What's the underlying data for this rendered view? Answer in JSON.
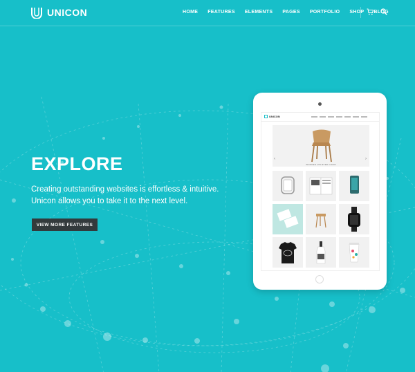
{
  "brand": {
    "name": "UNICON"
  },
  "nav": {
    "items": [
      "HOME",
      "FEATURES",
      "ELEMENTS",
      "PAGES",
      "PORTFOLIO",
      "SHOP",
      "BLOG"
    ],
    "icons": [
      "cart-icon",
      "search-icon"
    ]
  },
  "hero": {
    "title": "EXPLORE",
    "subtitle": "Creating outstanding websites is effortless & intuitive. Unicon allows you to take it to the next level.",
    "cta_label": "VIEW MORE FEATURES"
  },
  "tablet_screen": {
    "logo": "UNICON",
    "slider_caption": "WOODEN UPLIFTED CHAIR"
  },
  "colors": {
    "background": "#17bfc9",
    "button": "#333a3c",
    "text": "#ffffff"
  }
}
